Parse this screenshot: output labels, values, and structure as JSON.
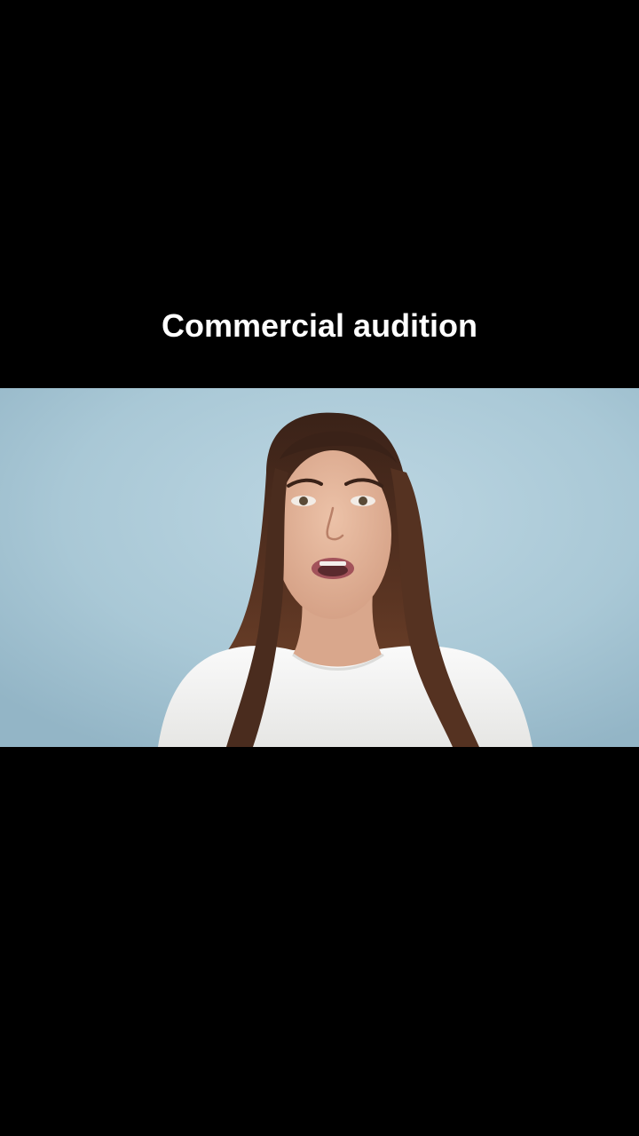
{
  "overlay": {
    "caption": "Commercial audition"
  },
  "video": {
    "subject": "woman-speaking-to-camera",
    "background_color": "#a9c8d6",
    "shirt_color": "#f4f4f2",
    "hair_color": "#4a2c1e",
    "skin_color": "#e3b49a"
  },
  "colors": {
    "letterbox": "#000000",
    "caption_text": "#ffffff"
  }
}
